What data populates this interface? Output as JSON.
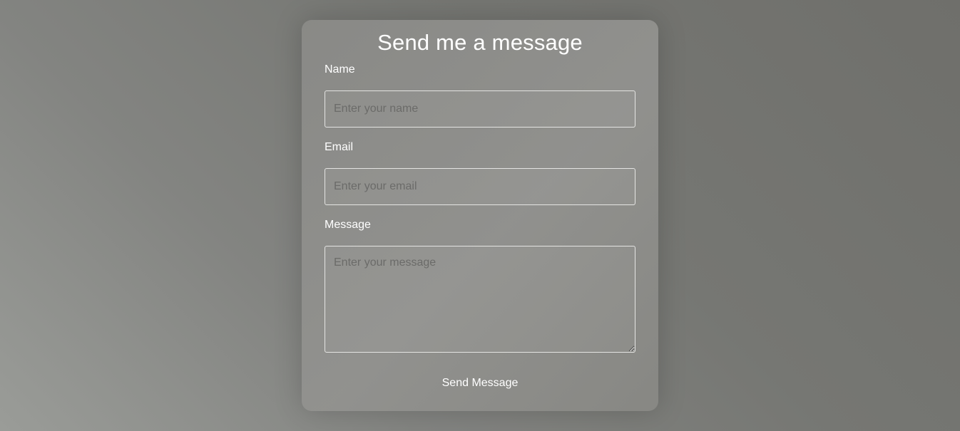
{
  "form": {
    "title": "Send me a message",
    "fields": [
      {
        "label": "Name",
        "placeholder": "Enter your name",
        "value": ""
      },
      {
        "label": "Email",
        "placeholder": "Enter your email",
        "value": ""
      },
      {
        "label": "Message",
        "placeholder": "Enter your message",
        "value": ""
      }
    ],
    "submit_label": "Send Message"
  },
  "colors": {
    "text": "#ffffff",
    "placeholder": "#6b6b69",
    "input_border": "#e4e4e2"
  }
}
